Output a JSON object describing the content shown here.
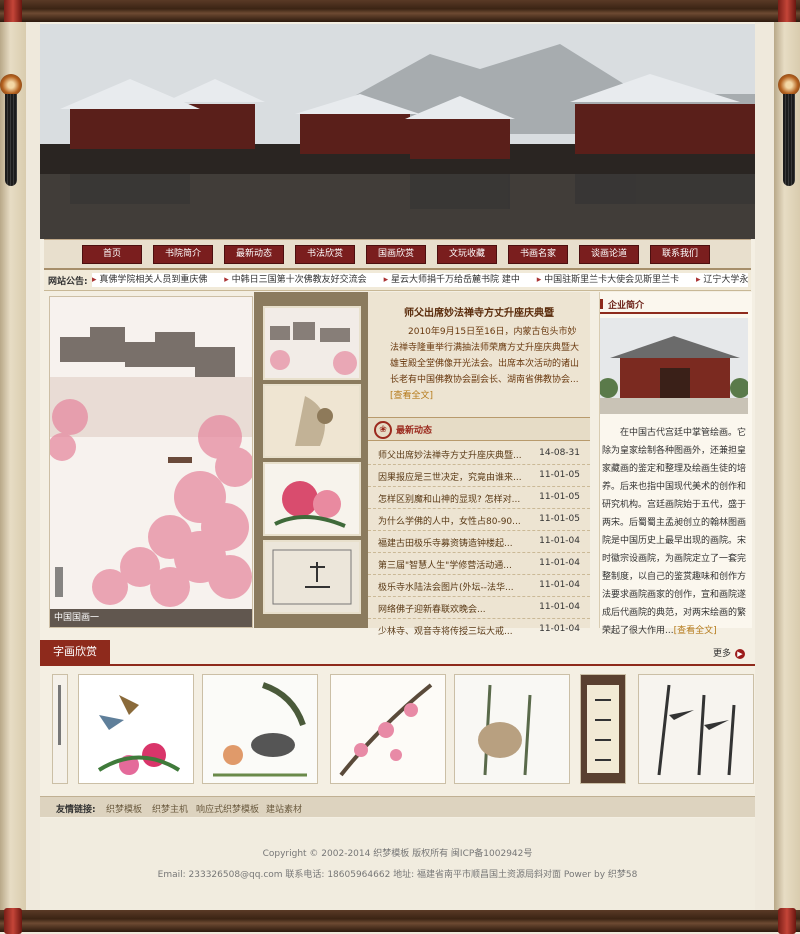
{
  "nav": {
    "items": [
      "首页",
      "书院简介",
      "最新动态",
      "书法欣赏",
      "国画欣赏",
      "文玩收藏",
      "书画名家",
      "谈画论道",
      "联系我们"
    ]
  },
  "notice": {
    "label": "网站公告:",
    "items": [
      "真佛学院相关人员到重庆佛",
      "中韩日三国第十次佛教友好交流会",
      "星云大师捐千万给岳麓书院 建中",
      "中国驻斯里兰卡大使会见斯里兰卡",
      "辽宁大学永惺佛"
    ]
  },
  "main_image": {
    "caption": "中国国画一"
  },
  "feature": {
    "title": "师父出席妙法禅寺方丈升座庆典暨",
    "summary": "2010年9月15日至16日，内蒙古包头市妙法禅寺隆重举行满抽法师荣膺方丈升座庆典暨大雄宝殿全堂佛像开光法会。出席本次活动的诸山长老有中国佛教协会副会长、湖南省佛教协会...",
    "read_more": "[查看全文]"
  },
  "latest": {
    "title": "最新动态",
    "items": [
      {
        "title": "师父出席妙法禅寺方丈升座庆典暨...",
        "date": "14-08-31"
      },
      {
        "title": "因果报应是三世决定，究竟由谁来...",
        "date": "11-01-05"
      },
      {
        "title": "怎样区别魔和山神的显现? 怎样对...",
        "date": "11-01-05"
      },
      {
        "title": "为什么学佛的人中，女性占80-90...",
        "date": "11-01-05"
      },
      {
        "title": "福建古田极乐寺募资铸造钟楼起...",
        "date": "11-01-04"
      },
      {
        "title": "第三届\"智慧人生\"学修营活动通...",
        "date": "11-01-04"
      },
      {
        "title": "极乐寺水陆法会图片(外坛--法华...",
        "date": "11-01-04"
      },
      {
        "title": "网络佛子迎新春联欢晚会...",
        "date": "11-01-04"
      },
      {
        "title": "少林寺、观音寺将传授三坛大戒...",
        "date": "11-01-04"
      }
    ]
  },
  "intro": {
    "title": "企业简介",
    "text": "在中国古代宫廷中掌管绘画。它除为皇家绘制各种图画外，还兼担皇家藏画的鉴定和整理及绘画生徒的培养。后来也指中国现代美术的创作和研究机构。宫廷画院始于五代，盛于两宋。后蜀蜀主孟昶创立的翰林图画院是中国历史上最早出现的画院。宋时徽宗设画院，为画院定立了一套完整制度，以自己的鉴赏趣味和创作方法要求画院画家的创作，宣和画院遂成后代画院的典范，对两宋绘画的繁荣起了很大作用...",
    "read_more": "[查看全文]"
  },
  "gallery": {
    "title": "字画欣赏",
    "more": "更多"
  },
  "links": {
    "label": "友情链接:",
    "items": [
      "织梦模板",
      "织梦主机",
      "响应式织梦模板",
      "建站素材"
    ]
  },
  "footer": {
    "line1": "Copyright © 2002-2014 织梦模板 版权所有 闽ICP备1002942号",
    "line2": "Email: 233326508@qq.com   联系电话: 18605964662 地址: 福建省南平市顺昌国土资源局斜对面 Power by 织梦58"
  }
}
